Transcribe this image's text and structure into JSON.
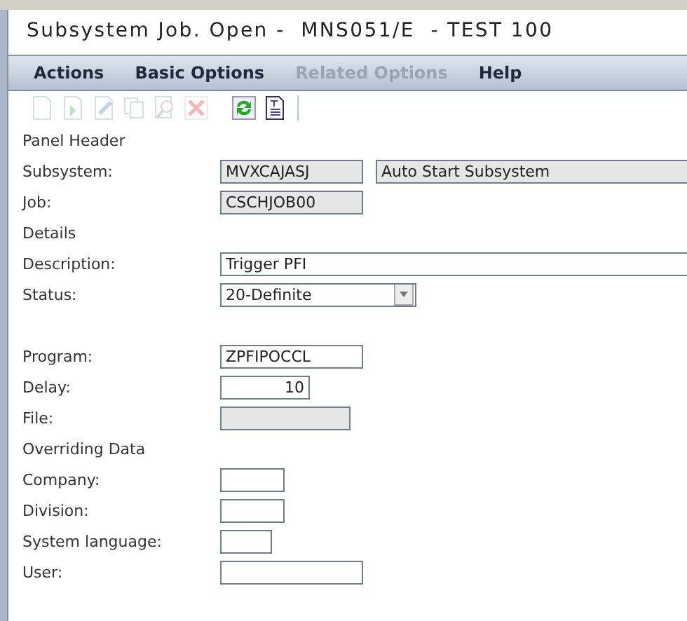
{
  "window": {
    "title": "Subsystem Job. Open -  MNS051/E  - TEST 100"
  },
  "menu": [
    {
      "label": "Actions",
      "disabled": false
    },
    {
      "label": "Basic Options",
      "disabled": false
    },
    {
      "label": "Related Options",
      "disabled": true
    },
    {
      "label": "Help",
      "disabled": false
    }
  ],
  "toolbar": [
    {
      "kind": "new",
      "disabled": true
    },
    {
      "kind": "import",
      "disabled": true
    },
    {
      "kind": "edit",
      "disabled": true
    },
    {
      "kind": "copy",
      "disabled": true
    },
    {
      "kind": "find",
      "disabled": true
    },
    {
      "kind": "delete",
      "disabled": true
    },
    {
      "kind": "refresh",
      "disabled": false
    },
    {
      "kind": "text",
      "disabled": false
    }
  ],
  "rows": [
    {
      "kind": "heading",
      "label": "Panel Header"
    },
    {
      "kind": "field",
      "label": "Subsystem:",
      "fields": [
        {
          "kind": "text",
          "value": "MVXCAJASJ",
          "disabled": true
        },
        {
          "kind": "text",
          "value": "Auto Start Subsystem",
          "disabled": true
        }
      ]
    },
    {
      "kind": "field",
      "label": "Job:",
      "fields": [
        {
          "kind": "text",
          "value": "CSCHJOB00",
          "disabled": true
        }
      ]
    },
    {
      "kind": "heading",
      "label": "Details"
    },
    {
      "kind": "field",
      "label": "Description:",
      "fields": [
        {
          "kind": "text",
          "value": "Trigger PFI",
          "disabled": false
        }
      ]
    },
    {
      "kind": "field",
      "label": "Status:",
      "fields": [
        {
          "kind": "select",
          "value": "20-Definite",
          "disabled": false
        }
      ]
    },
    {
      "kind": "spacer"
    },
    {
      "kind": "field",
      "label": "Program:",
      "fields": [
        {
          "kind": "text",
          "value": "ZPFIPOCCL",
          "disabled": false
        }
      ]
    },
    {
      "kind": "field",
      "label": "Delay:",
      "fields": [
        {
          "kind": "number",
          "value": "10",
          "disabled": false
        }
      ]
    },
    {
      "kind": "field",
      "label": "File:",
      "fields": [
        {
          "kind": "text",
          "disabled": true
        }
      ]
    },
    {
      "kind": "heading",
      "label": "Overriding Data"
    },
    {
      "kind": "field",
      "label": "Company:",
      "fields": [
        {
          "kind": "text",
          "disabled": false
        }
      ]
    },
    {
      "kind": "field",
      "label": "Division:",
      "fields": [
        {
          "kind": "text",
          "disabled": false
        }
      ]
    },
    {
      "kind": "field",
      "label": "System language:",
      "fields": [
        {
          "kind": "text",
          "disabled": false
        }
      ]
    },
    {
      "kind": "field",
      "label": "User:",
      "fields": [
        {
          "kind": "text",
          "disabled": false
        }
      ]
    }
  ]
}
